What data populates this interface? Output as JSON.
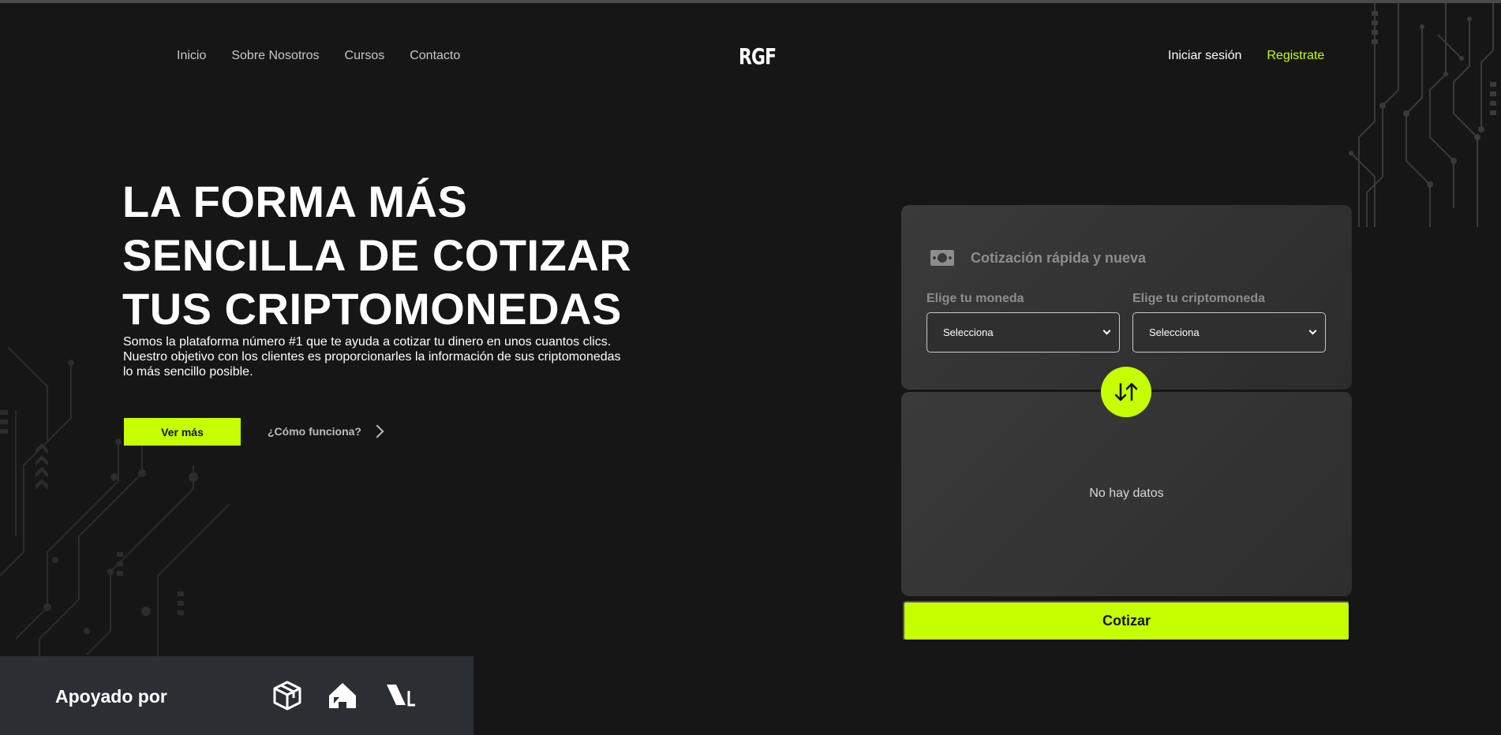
{
  "nav": {
    "links": [
      {
        "label": "Inicio"
      },
      {
        "label": "Sobre Nosotros"
      },
      {
        "label": "Cursos"
      },
      {
        "label": "Contacto"
      }
    ],
    "logo": "RGF",
    "login_label": "Iniciar sesión",
    "register_label": "Registrate"
  },
  "hero": {
    "title_lines": [
      "LA FORMA MÁS",
      "SENCILLA DE COTIZAR",
      "TUS CRIPTOMONEDAS"
    ],
    "description_lines": [
      "Somos la plataforma número #1 que te ayuda a cotizar tu dinero en unos cuantos clics.",
      "Nuestro objetivo con los clientes es proporcionarles la información de sus criptomonedas",
      "lo más sencillo posible."
    ],
    "more_button": "Ver más",
    "how_link": "¿Cómo funciona?"
  },
  "supported": {
    "label": "Apoyado por",
    "partner_icons": [
      "cube-icon",
      "house-icon",
      "slash-logo-icon"
    ]
  },
  "quote": {
    "title": "Cotización rápida y nueva",
    "title_icon": "money-bill-icon",
    "currency_label": "Elige tu moneda",
    "currency_value": "Selecciona",
    "crypto_label": "Elige tu criptomoneda",
    "crypto_value": "Selecciona",
    "swap_icon": "swap-arrows-icon",
    "empty_text": "No hay datos",
    "submit_label": "Cotizar"
  },
  "colors": {
    "background": "#161616",
    "accent": "#c6ff00",
    "card": "#333333",
    "supported_bar": "#2b2e32"
  }
}
